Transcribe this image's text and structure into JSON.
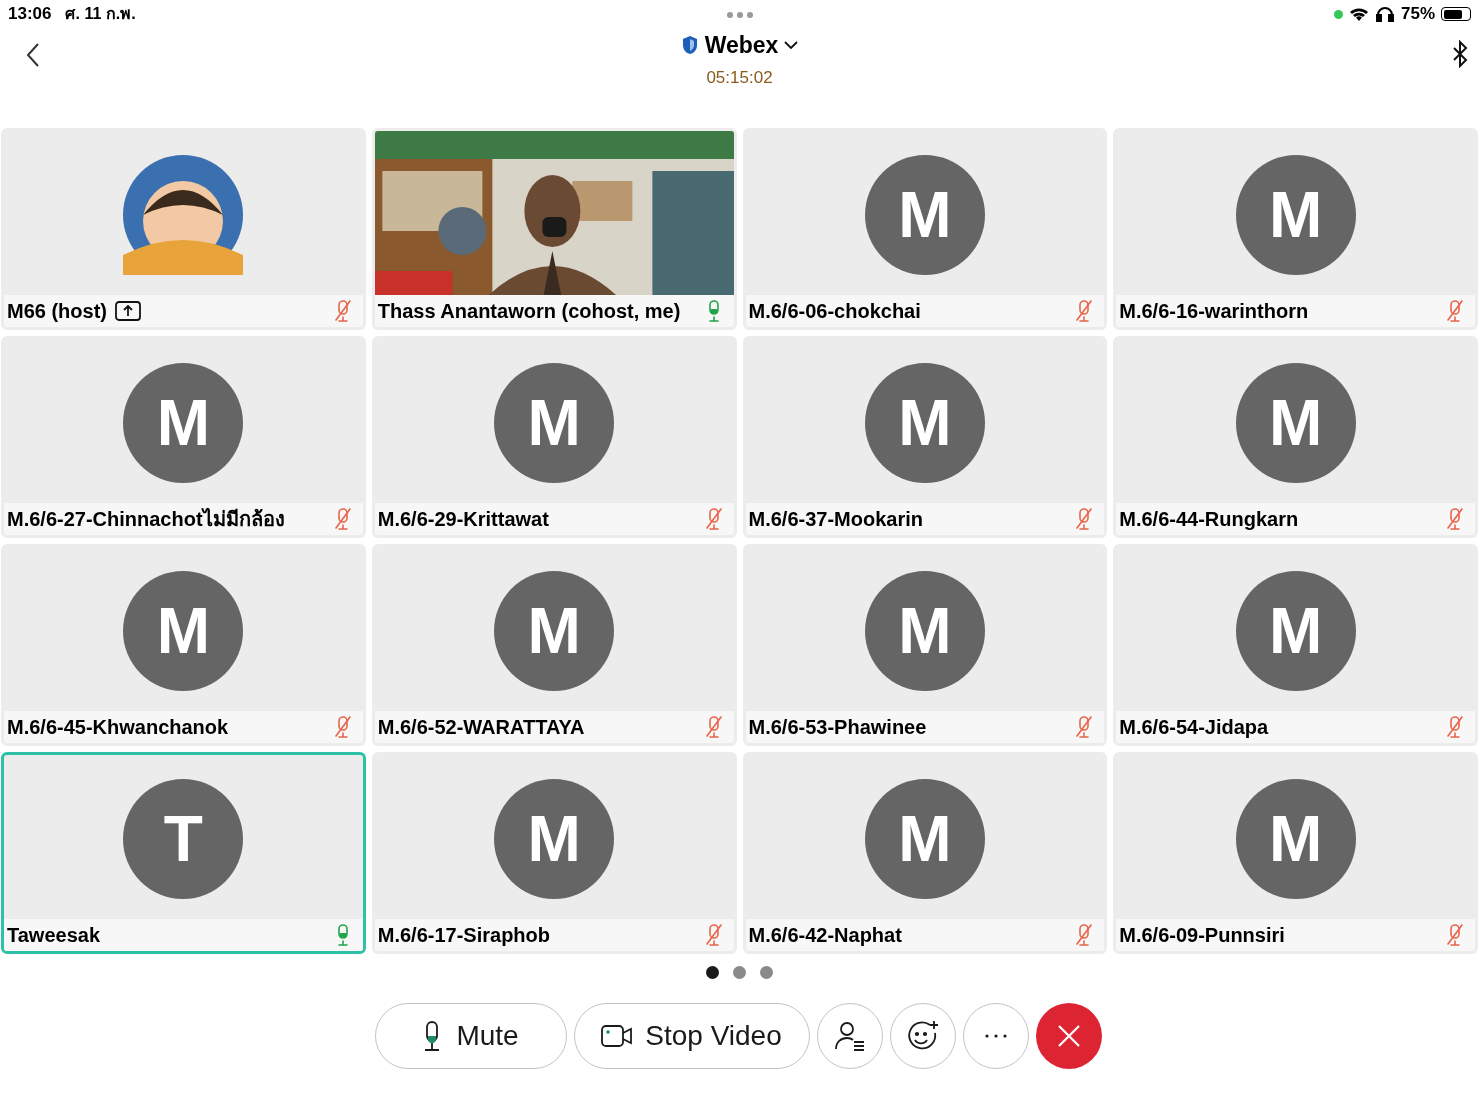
{
  "status_bar": {
    "time": "13:06",
    "date": "ศ. 11 ก.พ.",
    "battery": "75%"
  },
  "header": {
    "title": "Webex",
    "timer": "05:15:02"
  },
  "tile_rows": [
    {
      "participants": [
        {
          "name": "M66 (host)",
          "kind": "avatar_image",
          "sharing": true,
          "muted": true,
          "active_speaker": false
        },
        {
          "name": "Thass Anantaworn (cohost, me)",
          "kind": "video",
          "sharing": false,
          "muted": false,
          "active_speaker": false
        },
        {
          "name": "M.6/6-06-chokchai",
          "kind": "initial",
          "initial": "M",
          "sharing": false,
          "muted": true,
          "active_speaker": false
        },
        {
          "name": "M.6/6-16-warinthorn",
          "kind": "initial",
          "initial": "M",
          "sharing": false,
          "muted": true,
          "active_speaker": false
        }
      ]
    },
    {
      "participants": [
        {
          "name": "M.6/6-27-Chinnachotไม่มีกล้อง",
          "kind": "initial",
          "initial": "M",
          "sharing": false,
          "muted": true,
          "active_speaker": false
        },
        {
          "name": "M.6/6-29-Krittawat",
          "kind": "initial",
          "initial": "M",
          "sharing": false,
          "muted": true,
          "active_speaker": false
        },
        {
          "name": "M.6/6-37-Mookarin",
          "kind": "initial",
          "initial": "M",
          "sharing": false,
          "muted": true,
          "active_speaker": false
        },
        {
          "name": "M.6/6-44-Rungkarn",
          "kind": "initial",
          "initial": "M",
          "sharing": false,
          "muted": true,
          "active_speaker": false
        }
      ]
    },
    {
      "participants": [
        {
          "name": "M.6/6-45-Khwanchanok",
          "kind": "initial",
          "initial": "M",
          "sharing": false,
          "muted": true,
          "active_speaker": false
        },
        {
          "name": "M.6/6-52-WARATTAYA",
          "kind": "initial",
          "initial": "M",
          "sharing": false,
          "muted": true,
          "active_speaker": false
        },
        {
          "name": "M.6/6-53-Phawinee",
          "kind": "initial",
          "initial": "M",
          "sharing": false,
          "muted": true,
          "active_speaker": false
        },
        {
          "name": "M.6/6-54-Jidapa",
          "kind": "initial",
          "initial": "M",
          "sharing": false,
          "muted": true,
          "active_speaker": false
        }
      ]
    },
    {
      "participants": [
        {
          "name": "Taweesak",
          "kind": "initial",
          "initial": "T",
          "sharing": false,
          "muted": false,
          "active_speaker": true
        },
        {
          "name": "M.6/6-17-Siraphob",
          "kind": "initial",
          "initial": "M",
          "sharing": false,
          "muted": true,
          "active_speaker": false
        },
        {
          "name": "M.6/6-42-Naphat",
          "kind": "initial",
          "initial": "M",
          "sharing": false,
          "muted": true,
          "active_speaker": false
        },
        {
          "name": "M.6/6-09-Punnsiri",
          "kind": "initial",
          "initial": "M",
          "sharing": false,
          "muted": true,
          "active_speaker": false
        }
      ]
    }
  ],
  "pages": [
    {
      "selected": true
    },
    {
      "selected": false
    },
    {
      "selected": false
    }
  ],
  "controls": {
    "mute_label": "Mute",
    "video_label": "Stop Video"
  }
}
